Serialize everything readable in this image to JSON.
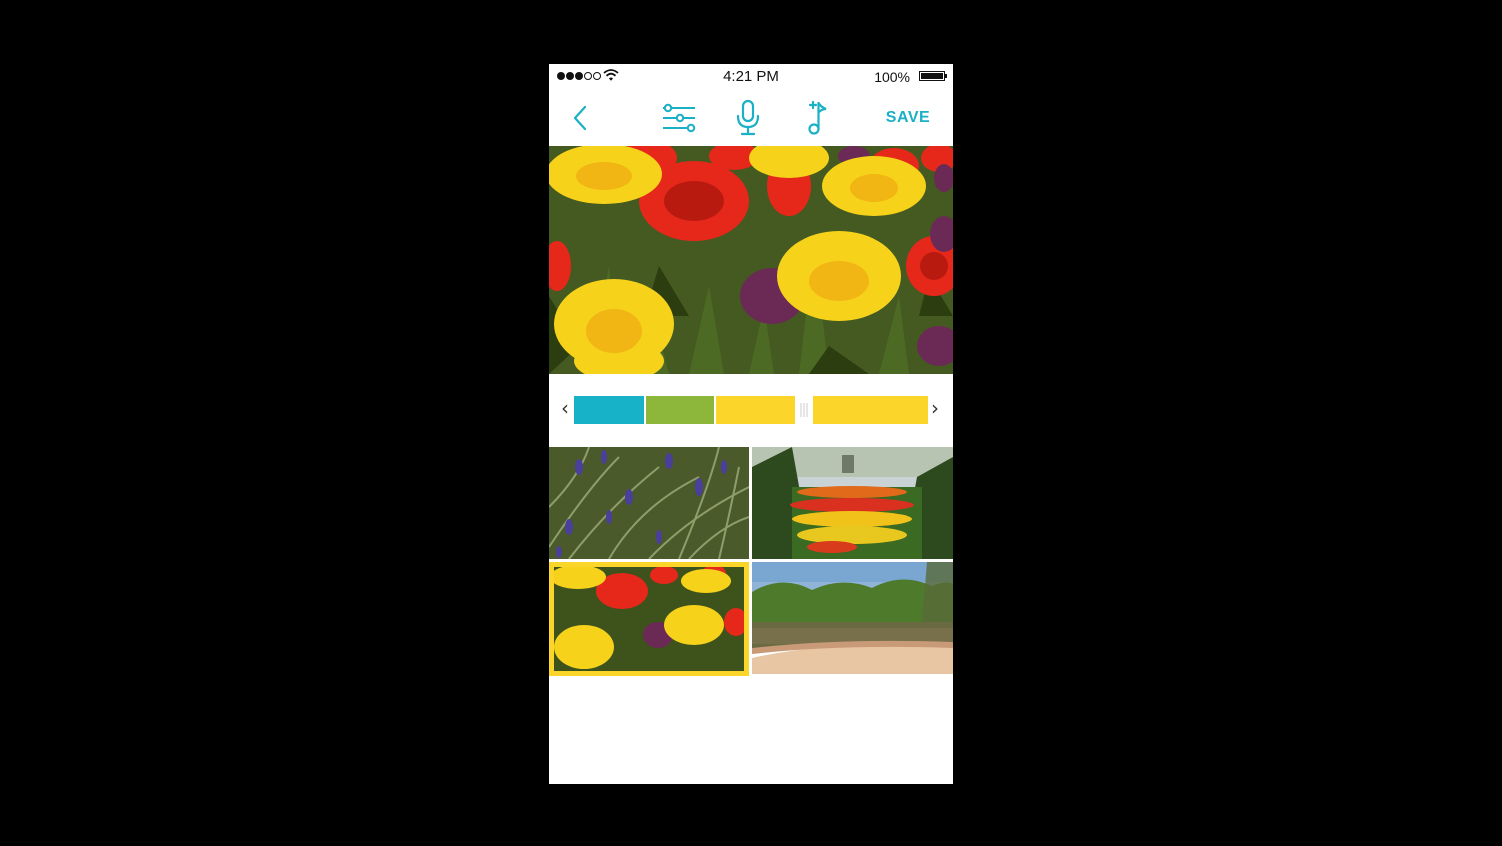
{
  "status_bar": {
    "time": "4:21 PM",
    "battery_percent": "100%",
    "signal_bars_filled": 3,
    "signal_bars_total": 5
  },
  "toolbar": {
    "back_icon": "chevron-left-icon",
    "adjust_icon": "sliders-icon",
    "mic_icon": "microphone-icon",
    "music_icon": "music-note-add-icon",
    "save_label": "SAVE"
  },
  "timeline": {
    "left_arrow": "‹",
    "right_arrow": "›",
    "segments": [
      {
        "color": "#17b2c8"
      },
      {
        "color": "#8db73a"
      },
      {
        "color": "#fcd52a"
      }
    ]
  },
  "thumbnails": [
    {
      "subject": "blue flowers with grass"
    },
    {
      "subject": "garden flower beds"
    },
    {
      "subject": "tulips",
      "selected": true
    },
    {
      "subject": "lake with trees"
    }
  ],
  "colors": {
    "accent": "#1ab0c6",
    "selected_border": "#fcd52a"
  }
}
